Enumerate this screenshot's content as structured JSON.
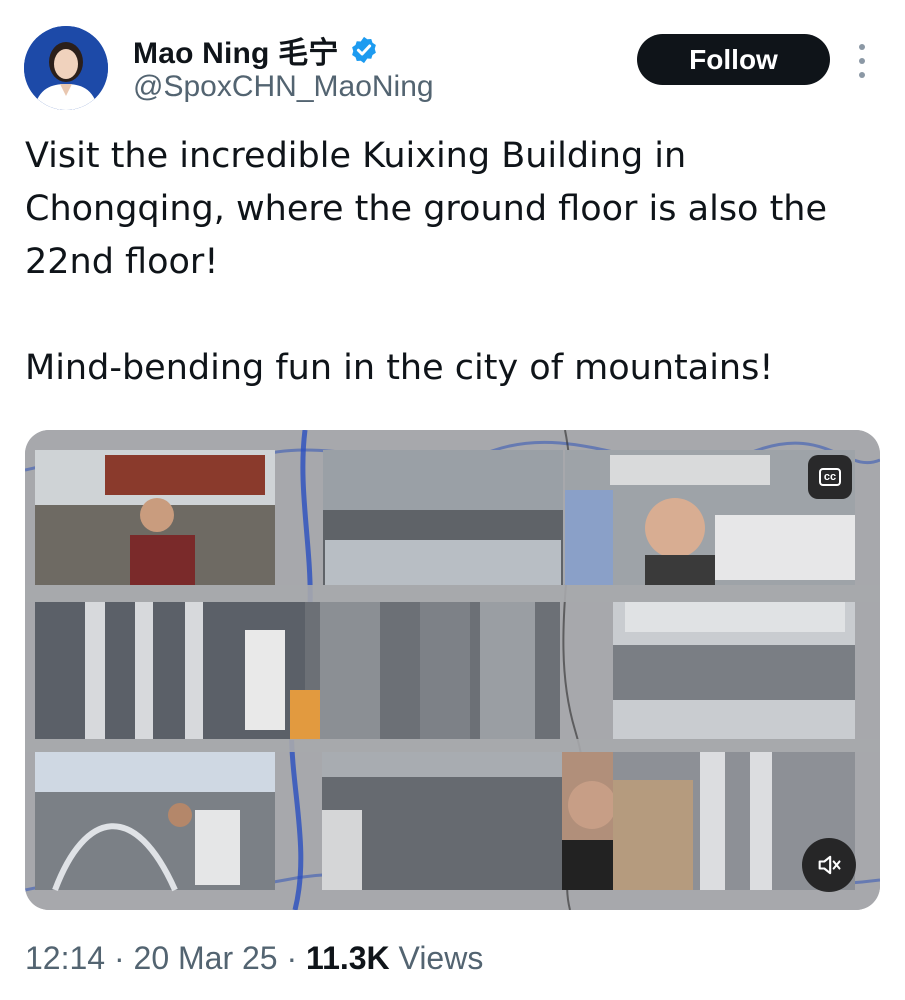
{
  "author": {
    "display_name": "Mao Ning 毛宁",
    "handle": "@SpoxCHN_MaoNing",
    "verified_icon": "verified-badge-icon",
    "badge_color": "#1d9bf0"
  },
  "actions": {
    "follow_label": "Follow",
    "more_icon": "more-vertical-icon"
  },
  "tweet": {
    "paragraphs": [
      "Visit the incredible Kuixing Building in Chongqing, where the ground floor is also the 22nd floor!",
      "Mind-bending fun in the city of mountains!"
    ]
  },
  "media": {
    "type": "video",
    "cc_label": "cc",
    "mute_icon": "speaker-muted-icon"
  },
  "meta": {
    "time": "12:14",
    "separator": "·",
    "date": "20 Mar 25",
    "views_count": "11.3K",
    "views_label": "Views"
  },
  "colors": {
    "text": "#0f1419",
    "secondary": "#536471",
    "follow_bg": "#0f1419"
  }
}
